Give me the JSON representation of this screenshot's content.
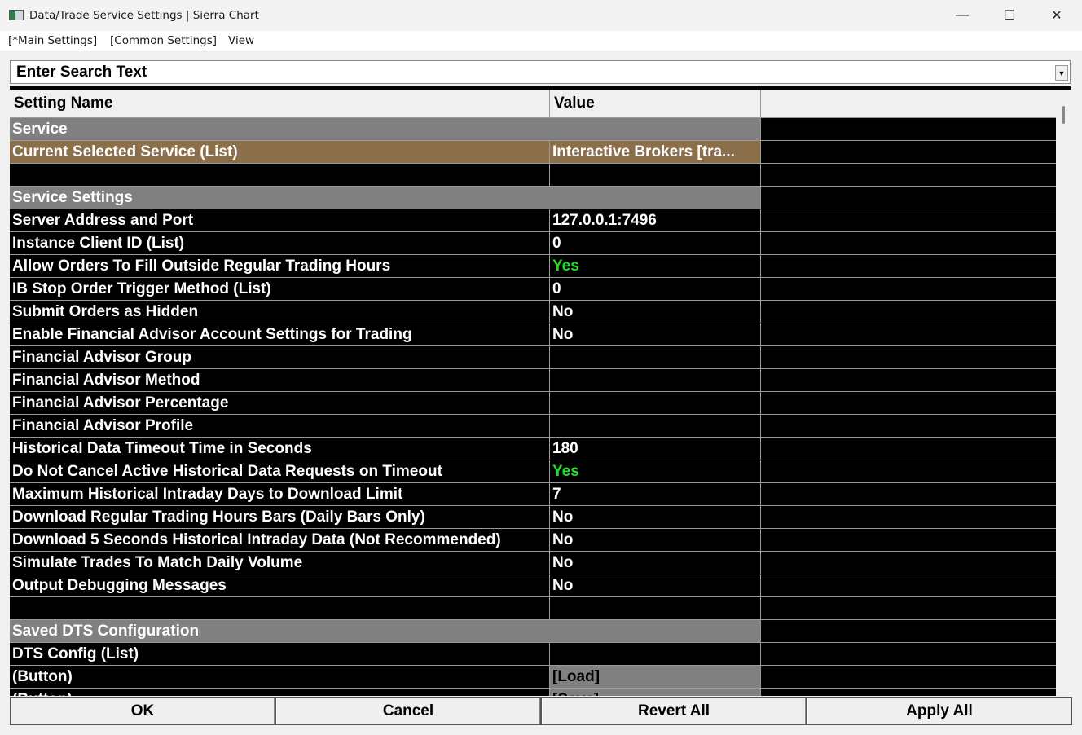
{
  "window": {
    "title": "Data/Trade Service Settings | Sierra Chart",
    "minimize": "—",
    "maximize": "☐",
    "close": "✕"
  },
  "menu": [
    "[*Main Settings]",
    "[Common Settings]",
    "View"
  ],
  "search": {
    "placeholder": "Enter Search Text"
  },
  "table": {
    "headers": [
      "Setting Name",
      "Value",
      ""
    ],
    "rows": [
      {
        "type": "group",
        "name": "Service"
      },
      {
        "type": "selected",
        "name": "Current Selected Service (List)",
        "value": "Interactive Brokers    [tra..."
      },
      {
        "type": "blank"
      },
      {
        "type": "group",
        "name": "Service Settings"
      },
      {
        "type": "setting",
        "name": "Server Address and Port",
        "value": "127.0.0.1:7496"
      },
      {
        "type": "setting",
        "name": "Instance Client ID (List)",
        "value": "0"
      },
      {
        "type": "setting",
        "name": "Allow Orders To Fill Outside Regular Trading Hours",
        "value": "Yes"
      },
      {
        "type": "setting",
        "name": "IB Stop Order Trigger Method (List)",
        "value": "0"
      },
      {
        "type": "setting",
        "name": "Submit Orders as Hidden",
        "value": "No"
      },
      {
        "type": "setting",
        "name": "Enable Financial Advisor Account Settings for Trading",
        "value": "No"
      },
      {
        "type": "setting",
        "name": "Financial Advisor Group",
        "value": ""
      },
      {
        "type": "setting",
        "name": "Financial Advisor Method",
        "value": ""
      },
      {
        "type": "setting",
        "name": "Financial Advisor Percentage",
        "value": ""
      },
      {
        "type": "setting",
        "name": "Financial Advisor Profile",
        "value": ""
      },
      {
        "type": "setting",
        "name": "Historical Data Timeout Time in Seconds",
        "value": "180"
      },
      {
        "type": "setting",
        "name": "Do Not Cancel Active Historical Data Requests on Timeout",
        "value": "Yes"
      },
      {
        "type": "setting",
        "name": "Maximum Historical Intraday Days to Download Limit",
        "value": "7"
      },
      {
        "type": "setting",
        "name": "Download Regular Trading Hours Bars (Daily Bars Only)",
        "value": "No"
      },
      {
        "type": "setting",
        "name": "Download 5 Seconds Historical Intraday Data (Not Recommended)",
        "value": "No"
      },
      {
        "type": "setting",
        "name": "Simulate Trades To Match Daily Volume",
        "value": "No"
      },
      {
        "type": "setting",
        "name": "Output Debugging Messages",
        "value": "No"
      },
      {
        "type": "blank"
      },
      {
        "type": "group",
        "name": "Saved DTS Configuration"
      },
      {
        "type": "setting",
        "name": "DTS Config (List)",
        "value": ""
      },
      {
        "type": "button",
        "name": " (Button)",
        "value": "[Load]"
      },
      {
        "type": "button",
        "name": " (Button)",
        "value": "[Save]"
      }
    ]
  },
  "colors": {
    "yes": "#20e020",
    "group": "#808080",
    "selected": "#8b6e4a"
  },
  "footer": {
    "ok": "OK",
    "cancel": "Cancel",
    "revert": "Revert All",
    "apply": "Apply All"
  }
}
